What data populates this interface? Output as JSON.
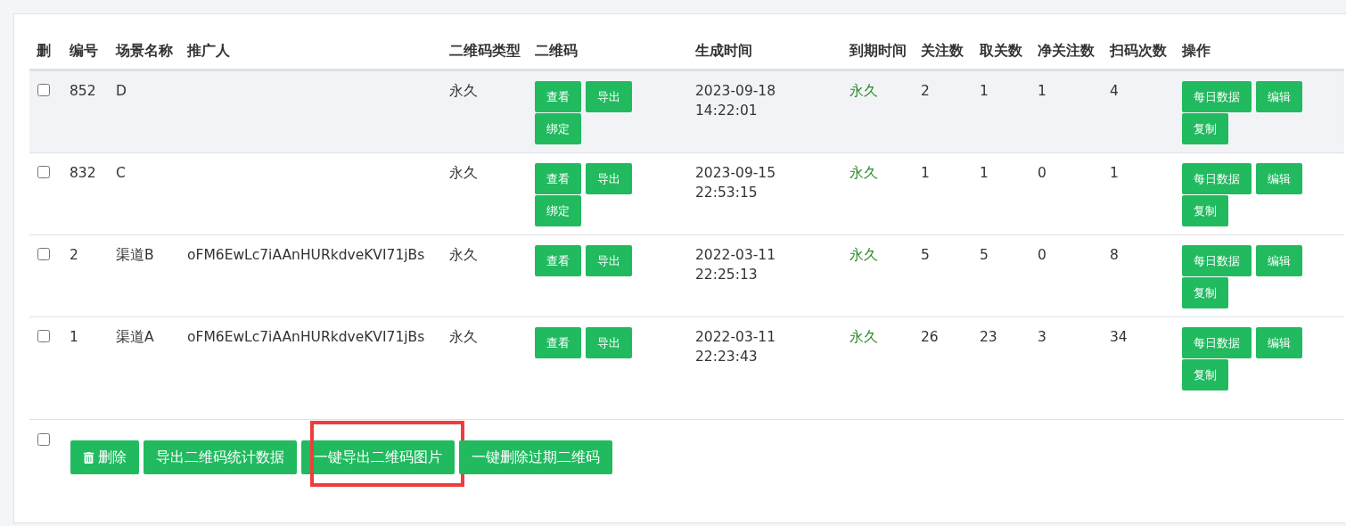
{
  "table": {
    "columns": [
      "删",
      "编号",
      "场景名称",
      "推广人",
      "二维码类型",
      "二维码",
      "生成时间",
      "到期时间",
      "关注数",
      "取关数",
      "净关注数",
      "扫码次数",
      "操作"
    ],
    "rows": [
      {
        "highlighted": true,
        "checked": false,
        "id": "852",
        "scene": "D",
        "promoter": "",
        "type": "永久",
        "qr_actions": [
          "查看",
          "导出",
          "绑定"
        ],
        "created": [
          "2023-09-18",
          "14:22:01"
        ],
        "expiry": "永久",
        "follows": "2",
        "unfollows": "1",
        "net": "1",
        "scans": "4",
        "actions": [
          "每日数据",
          "编辑",
          "复制"
        ]
      },
      {
        "highlighted": false,
        "checked": false,
        "id": "832",
        "scene": "C",
        "promoter": "",
        "type": "永久",
        "qr_actions": [
          "查看",
          "导出",
          "绑定"
        ],
        "created": [
          "2023-09-15",
          "22:53:15"
        ],
        "expiry": "永久",
        "follows": "1",
        "unfollows": "1",
        "net": "0",
        "scans": "1",
        "actions": [
          "每日数据",
          "编辑",
          "复制"
        ]
      },
      {
        "highlighted": false,
        "checked": false,
        "id": "2",
        "scene": "渠道B",
        "promoter": "oFM6EwLc7iAAnHURkdveKVI71jBs",
        "type": "永久",
        "qr_actions": [
          "查看",
          "导出"
        ],
        "created": [
          "2022-03-11",
          "22:25:13"
        ],
        "expiry": "永久",
        "follows": "5",
        "unfollows": "5",
        "net": "0",
        "scans": "8",
        "actions": [
          "每日数据",
          "编辑",
          "复制"
        ]
      },
      {
        "highlighted": false,
        "checked": false,
        "id": "1",
        "scene": "渠道A",
        "promoter": "oFM6EwLc7iAAnHURkdveKVI71jBs",
        "type": "永久",
        "qr_actions": [
          "查看",
          "导出"
        ],
        "created": [
          "2022-03-11",
          "22:23:43"
        ],
        "expiry": "永久",
        "follows": "26",
        "unfollows": "23",
        "net": "3",
        "scans": "34",
        "actions": [
          "每日数据",
          "编辑",
          "复制"
        ]
      }
    ]
  },
  "footer": {
    "select_all_checked": false,
    "buttons": [
      {
        "label": "删除",
        "kind": "delete",
        "highlighted": false
      },
      {
        "label": "导出二维码统计数据",
        "kind": "plain",
        "highlighted": false
      },
      {
        "label": "一键导出二维码图片",
        "kind": "plain",
        "highlighted": true
      },
      {
        "label": "一键删除过期二维码",
        "kind": "plain",
        "highlighted": false
      }
    ]
  }
}
